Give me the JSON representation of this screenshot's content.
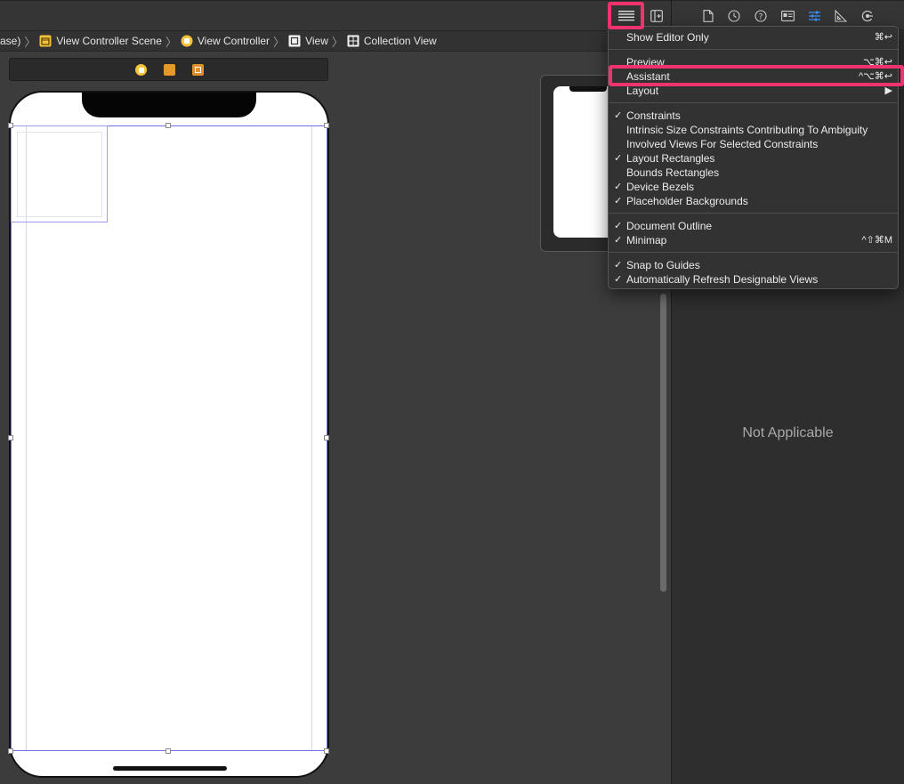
{
  "breadcrumb": [
    {
      "label": "ase)",
      "icon": "none"
    },
    {
      "label": "View Controller Scene",
      "icon": "scene-icon"
    },
    {
      "label": "View Controller",
      "icon": "view-controller-icon"
    },
    {
      "label": "View",
      "icon": "view-icon"
    },
    {
      "label": "Collection View",
      "icon": "collection-view-icon"
    }
  ],
  "inspector": {
    "empty_label": "Not Applicable"
  },
  "menu": {
    "items": [
      {
        "label": "Show Editor Only",
        "checked": false,
        "shortcut": "⌘↩"
      },
      {
        "label": "Preview",
        "checked": false,
        "shortcut": "⌥⌘↩"
      },
      {
        "label": "Assistant",
        "checked": false,
        "shortcut": "^⌥⌘↩"
      },
      {
        "label": "Layout",
        "checked": false,
        "shortcut": "▶"
      },
      {
        "label": "Constraints",
        "checked": true,
        "shortcut": ""
      },
      {
        "label": "Intrinsic Size Constraints Contributing To Ambiguity",
        "checked": false,
        "shortcut": ""
      },
      {
        "label": "Involved Views For Selected Constraints",
        "checked": false,
        "shortcut": ""
      },
      {
        "label": "Layout Rectangles",
        "checked": true,
        "shortcut": ""
      },
      {
        "label": "Bounds Rectangles",
        "checked": false,
        "shortcut": ""
      },
      {
        "label": "Device Bezels",
        "checked": true,
        "shortcut": ""
      },
      {
        "label": "Placeholder Backgrounds",
        "checked": true,
        "shortcut": ""
      },
      {
        "label": "Document Outline",
        "checked": true,
        "shortcut": ""
      },
      {
        "label": "Minimap",
        "checked": true,
        "shortcut": "^⇧⌘M"
      },
      {
        "label": "Snap to Guides",
        "checked": true,
        "shortcut": ""
      },
      {
        "label": "Automatically Refresh Designable Views",
        "checked": true,
        "shortcut": ""
      }
    ],
    "check_glyph": "✓"
  },
  "colors": {
    "highlight": "#f0336f",
    "selection": "#6f72e6",
    "accent": "#3b8ff5"
  }
}
